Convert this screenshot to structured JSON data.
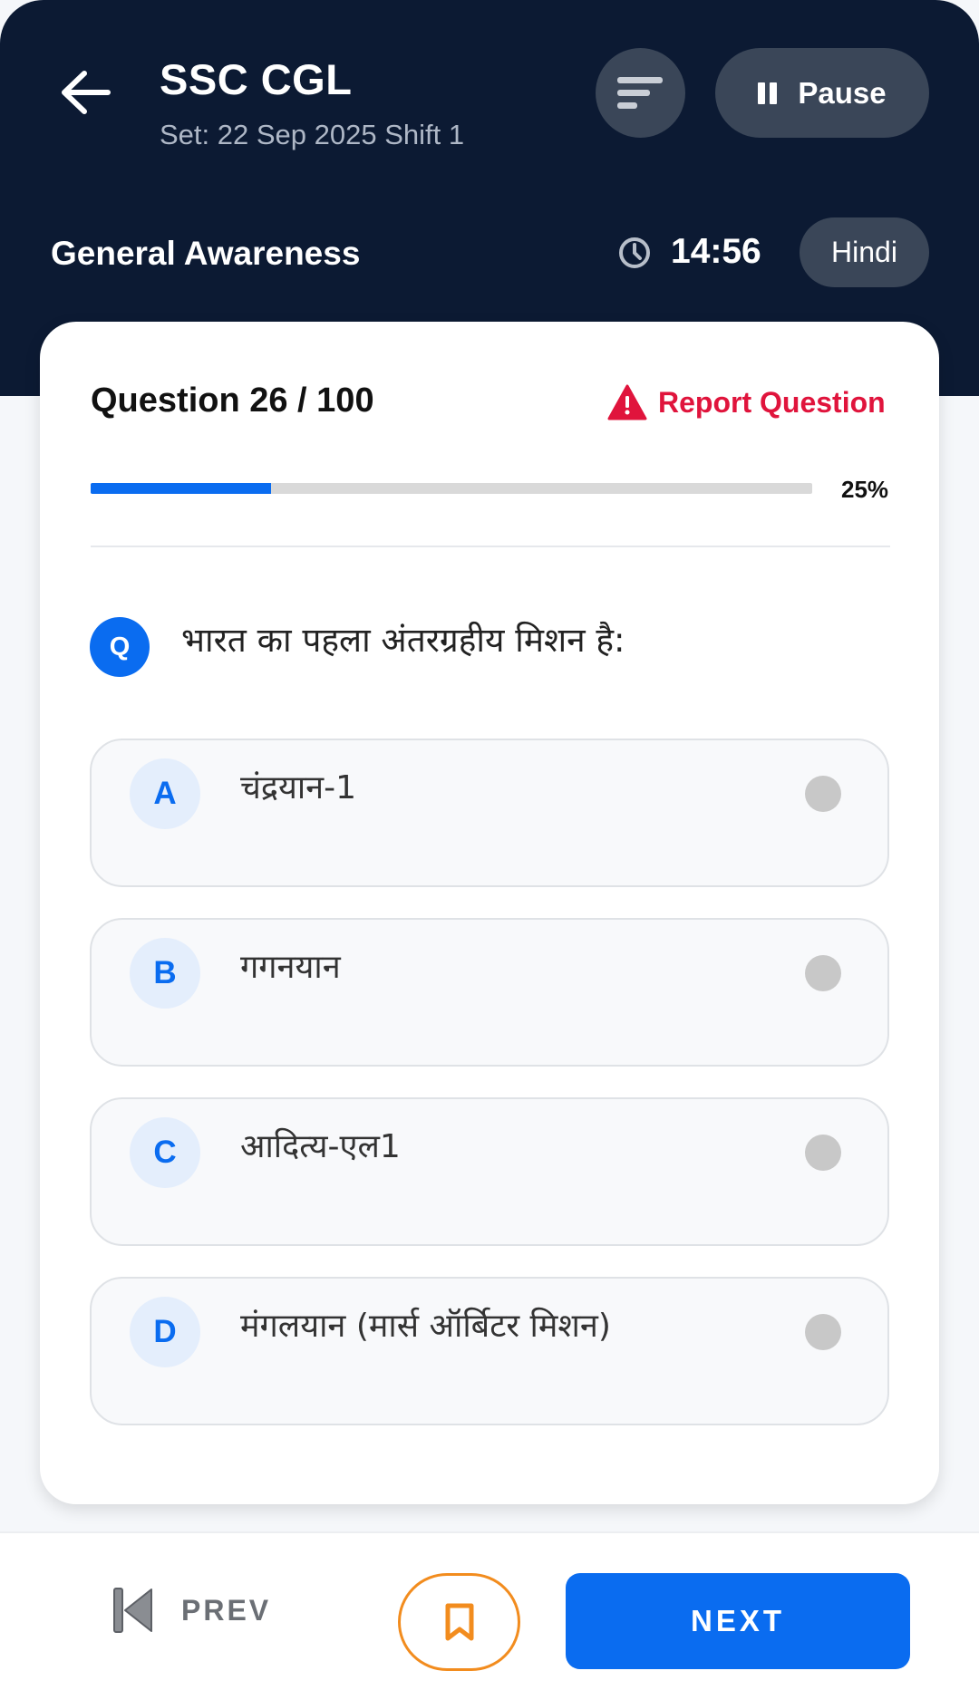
{
  "header": {
    "title": "SSC CGL",
    "subtitle": "Set: 22 Sep 2025 Shift 1",
    "pause_label": "Pause",
    "section": "General Awareness",
    "timer": "14:56",
    "language": "Hindi",
    "back_icon": "arrow-left-icon",
    "filter_icon": "sort-lines-icon",
    "pause_icon": "pause-icon",
    "timer_icon": "clock-icon"
  },
  "question": {
    "counter": "Question 26 / 100",
    "report_label": "Report Question",
    "report_icon": "warning-triangle-icon",
    "progress_percent": 25,
    "progress_label": "25%",
    "badge": "Q",
    "text": "भारत का पहला अंतरग्रहीय मिशन है:"
  },
  "options": [
    {
      "letter": "A",
      "text": "चंद्रयान-1"
    },
    {
      "letter": "B",
      "text": "गगनयान"
    },
    {
      "letter": "C",
      "text": "आदित्य-एल1"
    },
    {
      "letter": "D",
      "text": "मंगलयान (मार्स ऑर्बिटर मिशन)"
    }
  ],
  "footer": {
    "prev_label": "PREV",
    "next_label": "NEXT",
    "prev_icon": "skip-previous-icon",
    "bookmark_icon": "bookmark-icon"
  },
  "colors": {
    "header_bg": "#0c1a33",
    "accent": "#0a6cf0",
    "report": "#e0143c",
    "bookmark": "#f28c1e"
  }
}
